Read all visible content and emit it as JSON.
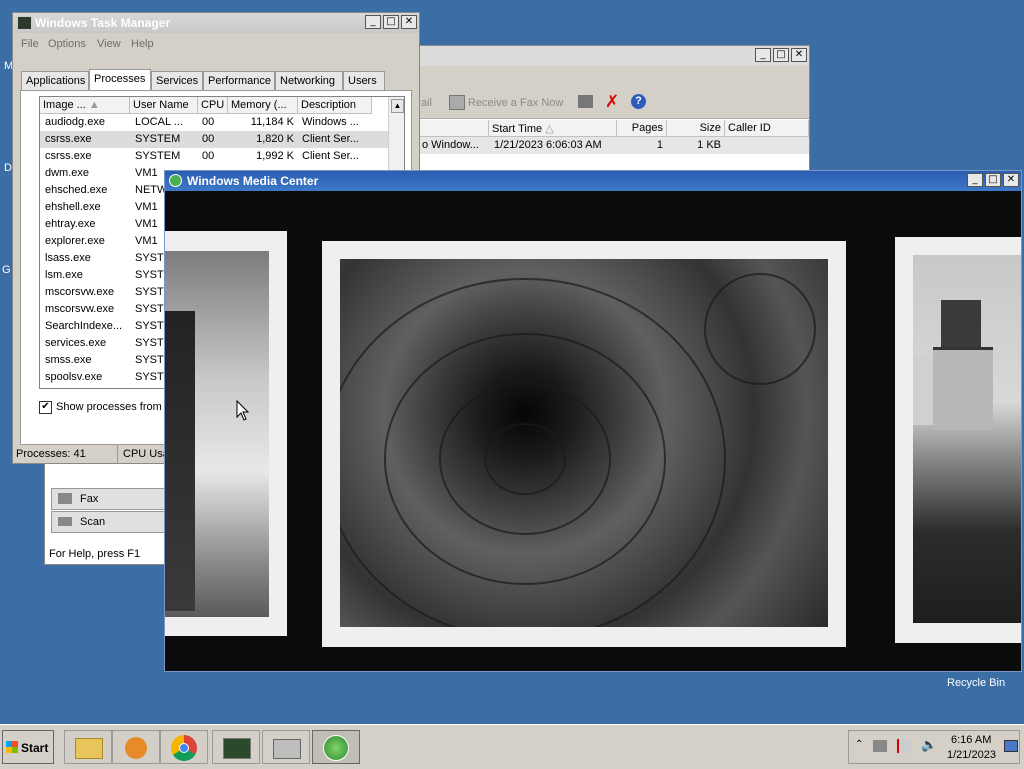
{
  "desktop": {
    "recycle_bin_label": "Recycle Bin",
    "left_letters": [
      "M",
      "D",
      "G"
    ]
  },
  "task_manager": {
    "title": "Windows Task Manager",
    "menu": [
      "File",
      "Options",
      "View",
      "Help"
    ],
    "tabs": [
      "Applications",
      "Processes",
      "Services",
      "Performance",
      "Networking",
      "Users"
    ],
    "selected_tab": "Processes",
    "columns": [
      "Image ...",
      "User Name",
      "CPU",
      "Memory (...",
      "Description"
    ],
    "rows": [
      {
        "image": "audiodg.exe",
        "user": "LOCAL ...",
        "cpu": "00",
        "mem": "11,184 K",
        "desc": "Windows ..."
      },
      {
        "image": "csrss.exe",
        "user": "SYSTEM",
        "cpu": "00",
        "mem": "1,820 K",
        "desc": "Client Ser..."
      },
      {
        "image": "csrss.exe",
        "user": "SYSTEM",
        "cpu": "00",
        "mem": "1,992 K",
        "desc": "Client Ser..."
      },
      {
        "image": "dwm.exe",
        "user": "VM1",
        "cpu": "",
        "mem": "",
        "desc": ""
      },
      {
        "image": "ehsched.exe",
        "user": "NETW",
        "cpu": "",
        "mem": "",
        "desc": ""
      },
      {
        "image": "ehshell.exe",
        "user": "VM1",
        "cpu": "",
        "mem": "",
        "desc": ""
      },
      {
        "image": "ehtray.exe",
        "user": "VM1",
        "cpu": "",
        "mem": "",
        "desc": ""
      },
      {
        "image": "explorer.exe",
        "user": "VM1",
        "cpu": "",
        "mem": "",
        "desc": ""
      },
      {
        "image": "lsass.exe",
        "user": "SYSTE",
        "cpu": "",
        "mem": "",
        "desc": ""
      },
      {
        "image": "lsm.exe",
        "user": "SYSTE",
        "cpu": "",
        "mem": "",
        "desc": ""
      },
      {
        "image": "mscorsvw.exe",
        "user": "SYSTE",
        "cpu": "",
        "mem": "",
        "desc": ""
      },
      {
        "image": "mscorsvw.exe",
        "user": "SYSTE",
        "cpu": "",
        "mem": "",
        "desc": ""
      },
      {
        "image": "SearchIndexe...",
        "user": "SYSTE",
        "cpu": "",
        "mem": "",
        "desc": ""
      },
      {
        "image": "services.exe",
        "user": "SYSTE",
        "cpu": "",
        "mem": "",
        "desc": ""
      },
      {
        "image": "smss.exe",
        "user": "SYSTE",
        "cpu": "",
        "mem": "",
        "desc": ""
      },
      {
        "image": "spoolsv.exe",
        "user": "SYSTE",
        "cpu": "",
        "mem": "",
        "desc": ""
      }
    ],
    "show_all_label": "Show processes from a",
    "status_processes": "Processes: 41",
    "status_cpu": "CPU Usa"
  },
  "fax_window": {
    "toolbar_receive": "Receive a Fax Now",
    "toolbar_mail_fragment": "ail",
    "columns": [
      "Start Time",
      "Pages",
      "Size",
      "Caller ID"
    ],
    "row": {
      "from": "o Window...",
      "start": "1/21/2023 6:06:03 AM",
      "pages": "1",
      "size": "1 KB",
      "caller": ""
    },
    "nav_fax": "Fax",
    "nav_scan": "Scan",
    "status": "For Help, press F1"
  },
  "media_center": {
    "title": "Windows Media Center"
  },
  "taskbar": {
    "start_label": "Start",
    "time": "6:16 AM",
    "date": "1/21/2023"
  }
}
